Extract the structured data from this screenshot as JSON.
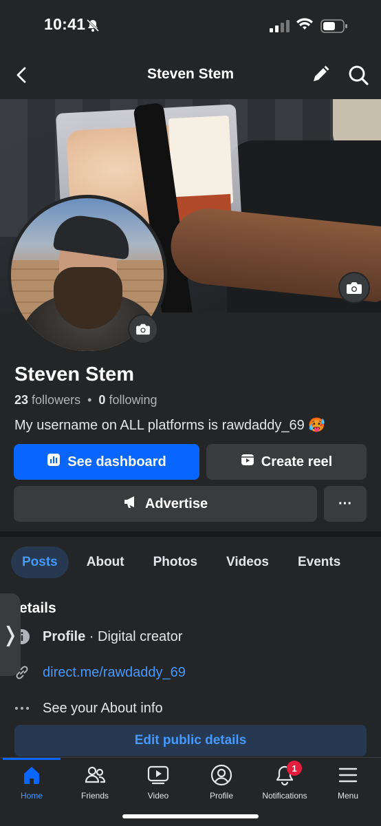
{
  "status_bar": {
    "time": "10:41",
    "icons": [
      "bell-off-icon",
      "signal-icon",
      "wifi-icon",
      "battery-icon"
    ]
  },
  "header": {
    "title": "Steven Stem",
    "icons": [
      "back-icon",
      "edit-pencil-icon",
      "search-icon"
    ]
  },
  "profile": {
    "name": "Steven Stem",
    "followers_count": "23",
    "followers_label": "followers",
    "separator": "•",
    "following_count": "0",
    "following_label": "following",
    "bio": "My username on ALL platforms is rawdaddy_69 🥵"
  },
  "actions": {
    "dashboard_label": "See dashboard",
    "reel_label": "Create reel",
    "advertise_label": "Advertise",
    "more_label": "···"
  },
  "tabs": [
    {
      "label": "Posts",
      "active": true
    },
    {
      "label": "About",
      "active": false
    },
    {
      "label": "Photos",
      "active": false
    },
    {
      "label": "Videos",
      "active": false
    },
    {
      "label": "Events",
      "active": false
    }
  ],
  "details": {
    "title": "etails",
    "drawer_glyph": "❭",
    "profile_label": "Profile",
    "profile_value": " · Digital creator",
    "link": "direct.me/rawdaddy_69",
    "about_label": "See your About info",
    "edit_button": "Edit public details"
  },
  "bottom_nav": [
    {
      "label": "Home",
      "icon": "home-icon",
      "active": true
    },
    {
      "label": "Friends",
      "icon": "friends-icon",
      "active": false
    },
    {
      "label": "Video",
      "icon": "video-icon",
      "active": false
    },
    {
      "label": "Profile",
      "icon": "profile-icon",
      "active": false
    },
    {
      "label": "Notifications",
      "icon": "bell-icon",
      "active": false,
      "badge": "1"
    },
    {
      "label": "Menu",
      "icon": "menu-icon",
      "active": false
    }
  ],
  "colors": {
    "background": "#242526",
    "primary": "#0866ff",
    "link": "#4599ff",
    "badge": "#e41e3f"
  }
}
